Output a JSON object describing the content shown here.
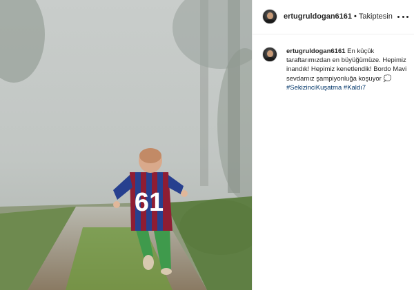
{
  "post": {
    "author": "ertugruldogan6161",
    "follow_status": "Takiptesin",
    "separator": "•"
  },
  "caption": {
    "author": "ertugruldogan6161",
    "text": "En küçük taraftarımızdan en büyüğümüze. Hepimiz inandık! Hepimiz kenetlendik! Bordo Mavi sevdamız şampiyonluğa koşuyor 💭",
    "hashtags": [
      "#SekizinciKuşatma",
      "#Kaldı7"
    ]
  },
  "photo": {
    "jersey_number": "61",
    "colors": {
      "claret": "#8f1d33",
      "blue": "#27408f",
      "grass": "#6f9b3e",
      "fog": "#c4c9c6"
    }
  },
  "icons": {
    "more": "more-options-icon"
  }
}
